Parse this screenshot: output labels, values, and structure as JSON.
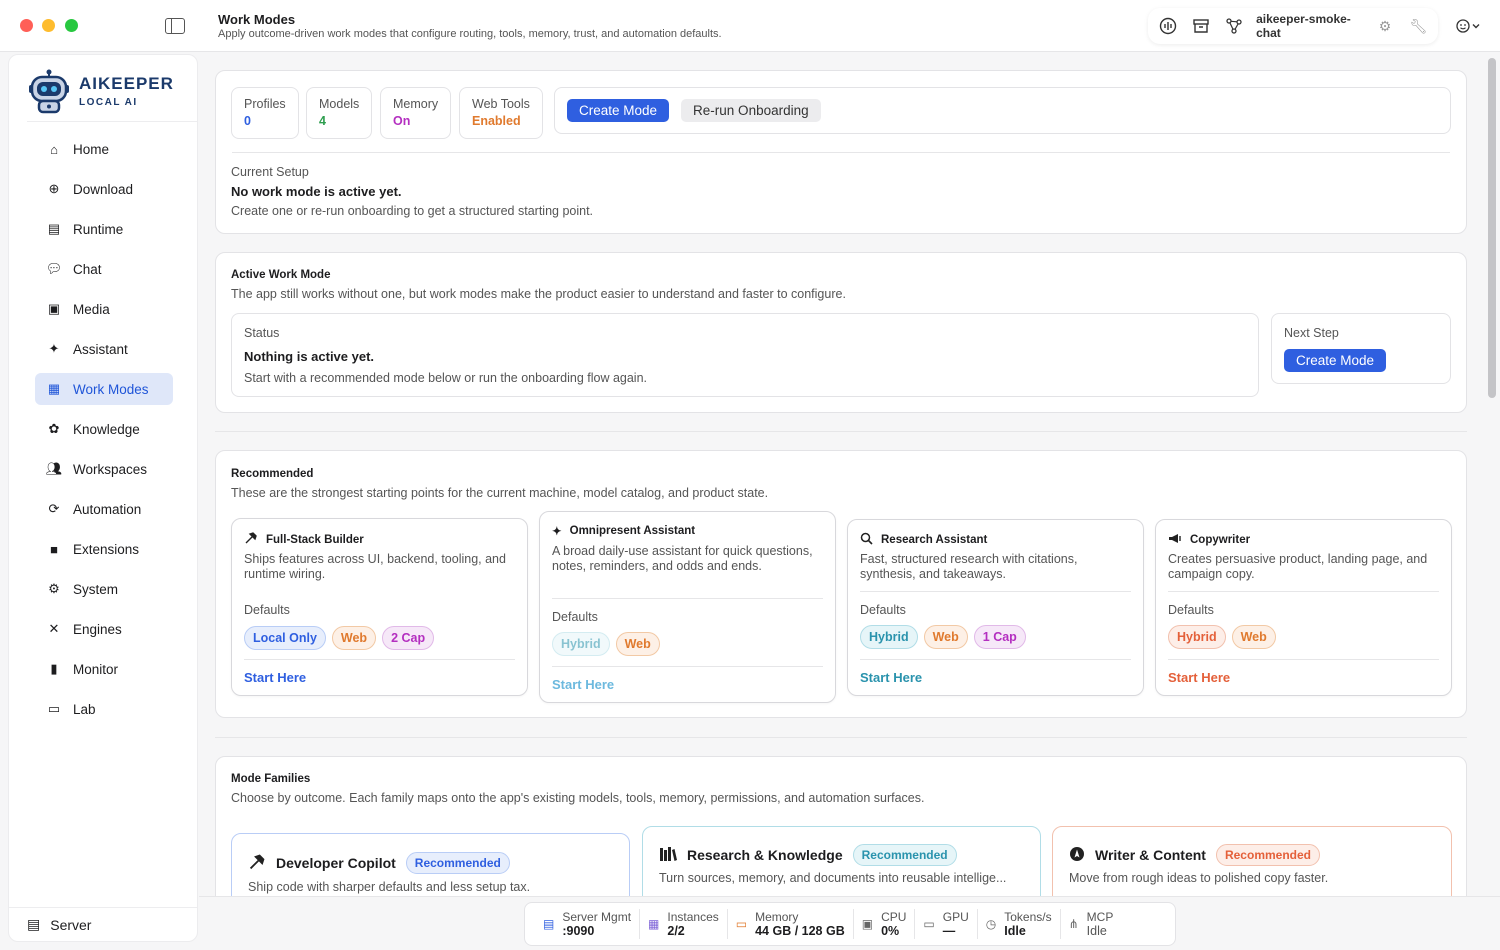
{
  "header": {
    "title": "Work Modes",
    "subtitle": "Apply outcome-driven work modes that configure routing, tools, memory, trust, and automation defaults.",
    "instance_name": "aikeeper-smoke-chat"
  },
  "brand": {
    "name": "AIKEEPER",
    "tagline": "LOCAL AI"
  },
  "sidebar": {
    "items": [
      {
        "label": "Home",
        "icon": "home-icon"
      },
      {
        "label": "Download",
        "icon": "download-icon"
      },
      {
        "label": "Runtime",
        "icon": "runtime-icon"
      },
      {
        "label": "Chat",
        "icon": "chat-icon"
      },
      {
        "label": "Media",
        "icon": "media-icon"
      },
      {
        "label": "Assistant",
        "icon": "sparkle-icon"
      },
      {
        "label": "Work Modes",
        "icon": "grid-icon"
      },
      {
        "label": "Knowledge",
        "icon": "brain-icon"
      },
      {
        "label": "Workspaces",
        "icon": "people-icon"
      },
      {
        "label": "Automation",
        "icon": "automation-icon"
      },
      {
        "label": "Extensions",
        "icon": "plug-icon"
      },
      {
        "label": "System",
        "icon": "gear-icon"
      },
      {
        "label": "Engines",
        "icon": "tools-icon"
      },
      {
        "label": "Monitor",
        "icon": "bars-icon"
      },
      {
        "label": "Lab",
        "icon": "terminal-icon"
      }
    ],
    "footer": "Server"
  },
  "overview": {
    "stats": [
      {
        "label": "Profiles",
        "value": "0",
        "color": "#2f5fe0"
      },
      {
        "label": "Models",
        "value": "4",
        "color": "#2e9e4f"
      },
      {
        "label": "Memory",
        "value": "On",
        "color": "#b42fc0"
      },
      {
        "label": "Web Tools",
        "value": "Enabled",
        "color": "#e07a2e"
      }
    ],
    "create_mode": "Create Mode",
    "rerun": "Re-run Onboarding",
    "current_setup_label": "Current Setup",
    "current_setup_title": "No work mode is active yet.",
    "current_setup_desc": "Create one or re-run onboarding to get a structured starting point."
  },
  "active": {
    "heading": "Active Work Mode",
    "desc": "The app still works without one, but work modes make the product easier to understand and faster to configure.",
    "status_label": "Status",
    "status_title": "Nothing is active yet.",
    "status_desc": "Start with a recommended mode below or run the onboarding flow again.",
    "next_label": "Next Step",
    "next_button": "Create Mode"
  },
  "recommended": {
    "heading": "Recommended",
    "desc": "These are the strongest starting points for the current machine, model catalog, and product state.",
    "defaults_label": "Defaults",
    "cards": [
      {
        "title": "Full-Stack Builder",
        "icon": "hammer-icon",
        "desc": "Ships features across UI, backend, tooling, and runtime wiring.",
        "chips": [
          "Local Only",
          "Web",
          "2 Cap"
        ],
        "start": "Start Here",
        "accent": "#2f5fe0"
      },
      {
        "title": "Omnipresent Assistant",
        "icon": "sparkle-icon",
        "desc": "A broad daily-use assistant for quick questions, notes, reminders, and odds and ends.",
        "chips": [
          "Hybrid",
          "Web"
        ],
        "start": "Start Here",
        "accent": "#4aa8d6"
      },
      {
        "title": "Research Assistant",
        "icon": "search-icon",
        "desc": "Fast, structured research with citations, synthesis, and takeaways.",
        "chips": [
          "Hybrid",
          "Web",
          "1 Cap"
        ],
        "start": "Start Here",
        "accent": "#2a93ad"
      },
      {
        "title": "Copywriter",
        "icon": "megaphone-icon",
        "desc": "Creates persuasive product, landing page, and campaign copy.",
        "chips": [
          "Hybrid",
          "Web"
        ],
        "start": "Start Here",
        "accent": "#e4603a"
      }
    ]
  },
  "families": {
    "heading": "Mode Families",
    "desc": "Choose by outcome. Each family maps onto the app's existing models, tools, memory, permissions, and automation surfaces.",
    "badge": "Recommended",
    "cards": [
      {
        "title": "Developer Copilot",
        "icon": "hammer-icon",
        "desc": "Ship code with sharper defaults and less setup tax."
      },
      {
        "title": "Research & Knowledge",
        "icon": "books-icon",
        "desc": "Turn sources, memory, and documents into reusable intellige..."
      },
      {
        "title": "Writer & Content",
        "icon": "compass-icon",
        "desc": "Move from rough ideas to polished copy faster."
      }
    ]
  },
  "statusbar": [
    {
      "label": "Server Mgmt",
      "value": ":9090",
      "icon": "server-icon"
    },
    {
      "label": "Instances",
      "value": "2/2",
      "icon": "grid-icon"
    },
    {
      "label": "Memory",
      "value": "44 GB / 128 GB",
      "icon": "memory-icon"
    },
    {
      "label": "CPU",
      "value": "0%",
      "icon": "cpu-icon"
    },
    {
      "label": "GPU",
      "value": "—",
      "icon": "gpu-icon"
    },
    {
      "label": "Tokens/s",
      "value": "Idle",
      "icon": "gauge-icon"
    },
    {
      "label": "MCP",
      "value": "Idle",
      "icon": "network-icon"
    }
  ]
}
